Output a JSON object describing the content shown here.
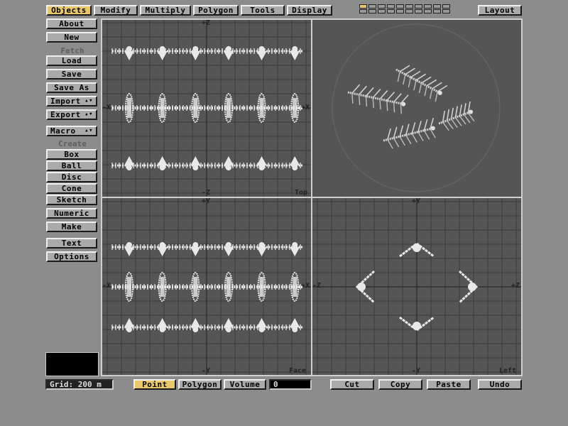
{
  "top_tabs": [
    {
      "label": "Objects",
      "active": true
    },
    {
      "label": "Modify",
      "active": false
    },
    {
      "label": "Multiply",
      "active": false
    },
    {
      "label": "Polygon",
      "active": false
    },
    {
      "label": "Tools",
      "active": false
    },
    {
      "label": "Display",
      "active": false
    }
  ],
  "layout_button": "Layout",
  "sidebar": {
    "about": "About",
    "new": "New",
    "fetch_label": "Fetch",
    "load": "Load",
    "save": "Save",
    "save_as": "Save As",
    "import": "Import",
    "export": "Export",
    "macro": "Macro",
    "create_label": "Create",
    "box": "Box",
    "ball": "Ball",
    "disc": "Disc",
    "cone": "Cone",
    "sketch": "Sketch",
    "numeric": "Numeric",
    "make": "Make",
    "text": "Text",
    "options": "Options"
  },
  "viewports": {
    "top": {
      "name": "Top",
      "up": "+Z",
      "down": "-Z",
      "left": "-X",
      "right": "+X"
    },
    "face": {
      "name": "Face",
      "up": "+Y",
      "down": "-Y",
      "left": "-X",
      "right": "+X"
    },
    "left": {
      "name": "Left",
      "up": "+Y",
      "down": "-Y",
      "left": "-Z",
      "right": "+Z"
    }
  },
  "bottom": {
    "grid": "Grid: 200 m",
    "modes": [
      {
        "label": "Point",
        "active": true
      },
      {
        "label": "Polygon",
        "active": false
      },
      {
        "label": "Volume",
        "active": false
      }
    ],
    "count": "0",
    "cut": "Cut",
    "copy": "Copy",
    "paste": "Paste",
    "undo": "Undo"
  },
  "colors": {
    "active": "#e8c86a",
    "button": "#aaaaaa",
    "viewport": "#555555",
    "mesh": "#e8e8e8",
    "grid": "#3c3c3c"
  }
}
